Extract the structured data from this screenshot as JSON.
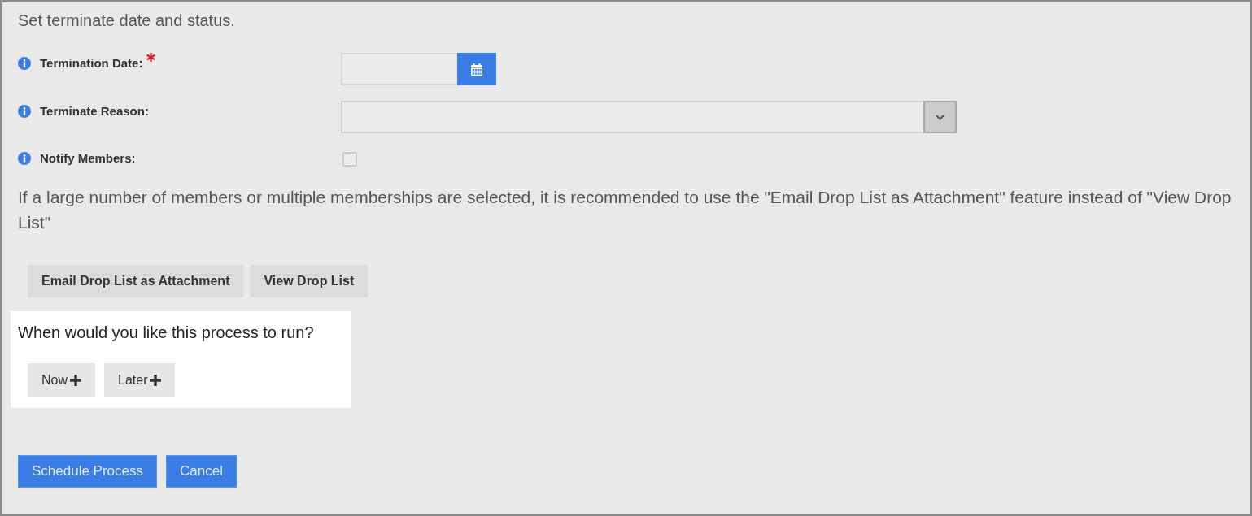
{
  "heading": "Set terminate date and status.",
  "fields": [
    {
      "kind": "date",
      "label": "Termination Date:",
      "required": true
    },
    {
      "kind": "select",
      "label": "Terminate Reason:",
      "required": false
    },
    {
      "kind": "checkbox",
      "label": "Notify Members:",
      "required": false,
      "checked": false
    }
  ],
  "notice": "If a large number of members or multiple memberships are selected, it is recommended to use the \"Email Drop List as Attachment\" feature instead of \"View Drop List\"",
  "drop_list_buttons": [
    "Email Drop List as Attachment",
    "View Drop List"
  ],
  "schedule": {
    "question": "When would you like this process to run?",
    "options": [
      {
        "label": "Now",
        "selected": false
      },
      {
        "label": "Later",
        "selected": false
      }
    ]
  },
  "actions": [
    "Schedule Process",
    "Cancel"
  ]
}
